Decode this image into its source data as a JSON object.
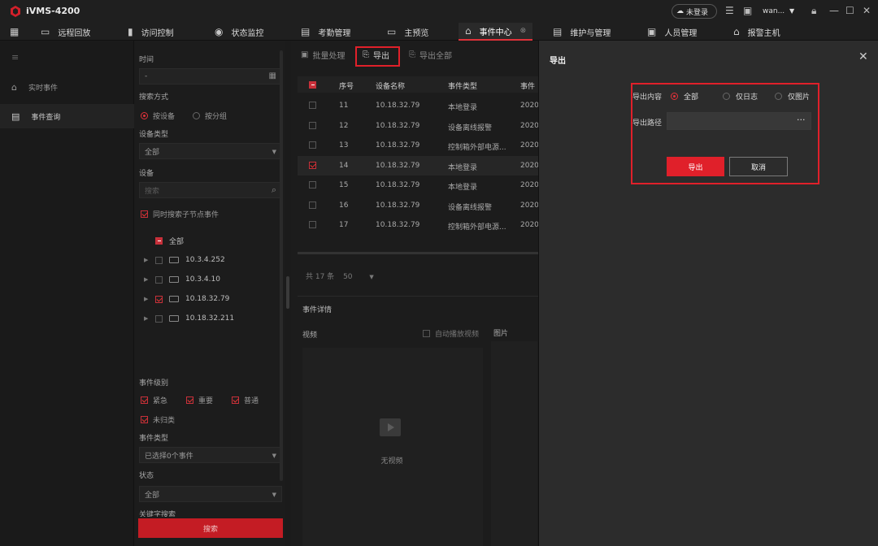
{
  "app": {
    "title": "iVMS-4200",
    "login_status": "未登录",
    "user": "wan..."
  },
  "colors": {
    "accent": "#e0202a",
    "background": "#1b1b1b",
    "panel": "#2c2c2c"
  },
  "menu": [
    {
      "label": "远程回放",
      "icon": "playback-icon"
    },
    {
      "label": "访问控制",
      "icon": "door-icon"
    },
    {
      "label": "状态监控",
      "icon": "monitor-icon"
    },
    {
      "label": "考勤管理",
      "icon": "calendar-icon"
    },
    {
      "label": "主预览",
      "icon": "camera-icon"
    },
    {
      "label": "事件中心",
      "icon": "alarm-icon",
      "active": true
    },
    {
      "label": "维护与管理",
      "icon": "maintenance-icon"
    },
    {
      "label": "人员管理",
      "icon": "person-icon"
    },
    {
      "label": "报警主机",
      "icon": "alarm-host-icon"
    }
  ],
  "leftnav": {
    "items": [
      {
        "label": "实时事件"
      },
      {
        "label": "事件查询",
        "active": true
      }
    ]
  },
  "filter": {
    "time_label": "时间",
    "time_value": "-",
    "search_mode_label": "搜索方式",
    "by_device": "按设备",
    "by_group": "按分组",
    "device_type_label": "设备类型",
    "device_type_value": "全部",
    "device_label": "设备",
    "device_search_placeholder": "搜索",
    "include_children": "同时搜索子节点事件",
    "tree_all": "全部",
    "devices": [
      "10.3.4.252",
      "10.3.4.10",
      "10.18.32.79",
      "10.18.32.211"
    ],
    "level_label": "事件级别",
    "levels": [
      "紧急",
      "重要",
      "普通",
      "未归类"
    ],
    "event_type_label": "事件类型",
    "event_type_value": "已选择0个事件",
    "status_label": "状态",
    "status_value": "全部",
    "more_label": "关键字搜索",
    "search_button": "搜索"
  },
  "toolbar": {
    "batch": "批量处理",
    "export": "导出",
    "export_all": "导出全部"
  },
  "table": {
    "headers": [
      "序号",
      "设备名称",
      "事件类型",
      "事件"
    ],
    "rows": [
      {
        "no": "11",
        "device": "10.18.32.79",
        "type": "本地登录",
        "time": "2020"
      },
      {
        "no": "12",
        "device": "10.18.32.79",
        "type": "设备离线报警",
        "time": "2020"
      },
      {
        "no": "13",
        "device": "10.18.32.79",
        "type": "控制箱外部电源...",
        "time": "2020"
      },
      {
        "no": "14",
        "device": "10.18.32.79",
        "type": "本地登录",
        "time": "2020",
        "checked": true
      },
      {
        "no": "15",
        "device": "10.18.32.79",
        "type": "本地登录",
        "time": "2020"
      },
      {
        "no": "16",
        "device": "10.18.32.79",
        "type": "设备离线报警",
        "time": "2020"
      },
      {
        "no": "17",
        "device": "10.18.32.79",
        "type": "控制箱外部电源...",
        "time": "2020"
      }
    ]
  },
  "pager": {
    "total": "共 17 条",
    "page_size": "50"
  },
  "detail": {
    "title": "事件详情",
    "video": "视频",
    "autoplay": "自动播放视频",
    "picture": "图片",
    "no_video": "无视频"
  },
  "export_panel": {
    "title": "导出",
    "content_label": "导出内容",
    "options": [
      "全部",
      "仅日志",
      "仅图片"
    ],
    "path_label": "导出路径",
    "export_button": "导出",
    "cancel_button": "取消"
  }
}
